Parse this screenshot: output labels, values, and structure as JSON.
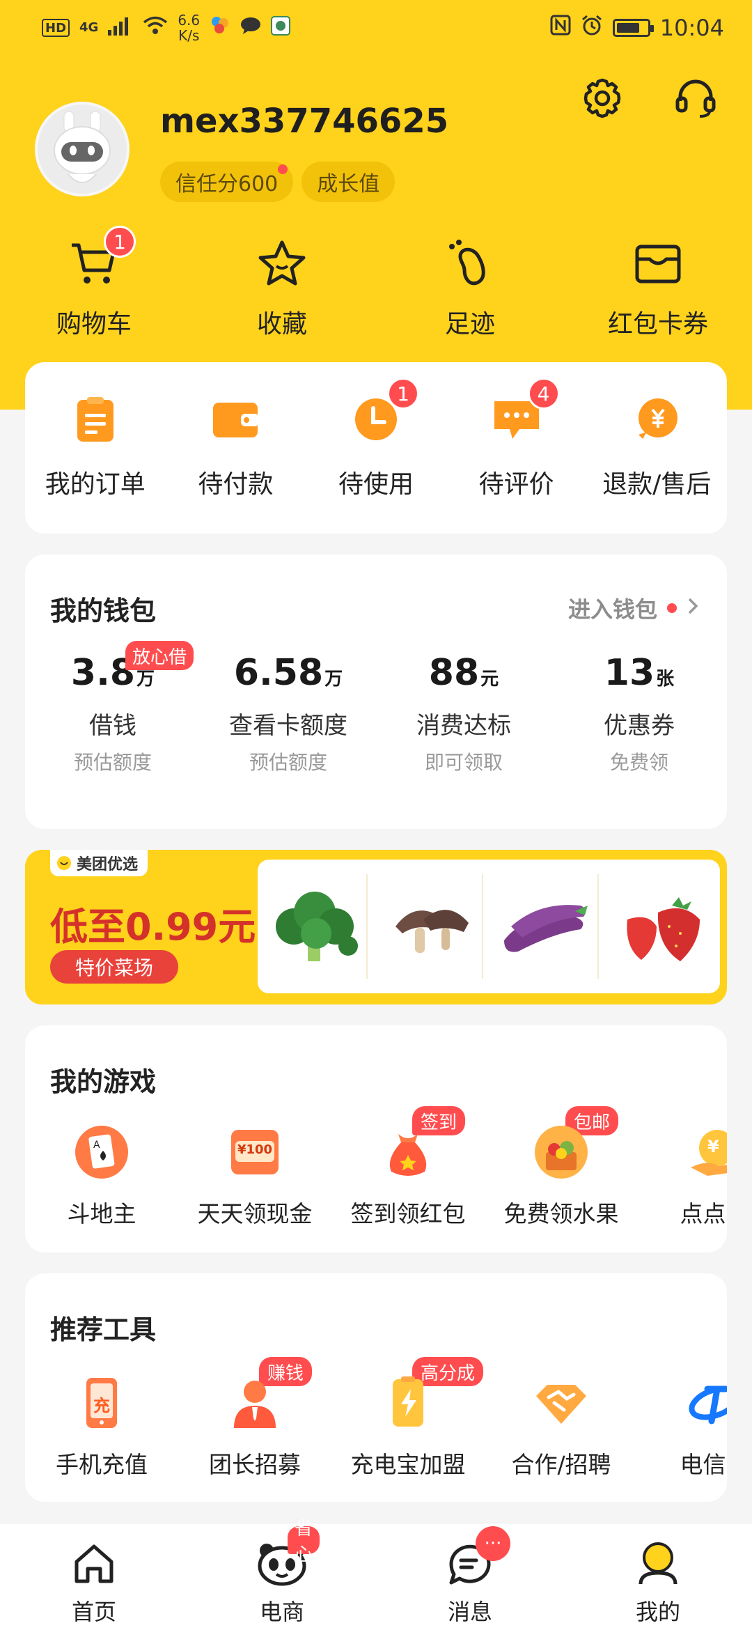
{
  "status_bar": {
    "network_chip": "HD",
    "network_type": "4G",
    "speed_value": "6.6",
    "speed_unit": "K/s",
    "time": "10:04",
    "battery_percent": 75
  },
  "profile": {
    "username": "mex337746625",
    "trust_score": "信任分600",
    "growth": "成长值"
  },
  "shortcuts": [
    {
      "label": "购物车",
      "icon": "cart-icon",
      "badge": "1"
    },
    {
      "label": "收藏",
      "icon": "star-icon"
    },
    {
      "label": "足迹",
      "icon": "footprint-icon"
    },
    {
      "label": "红包卡券",
      "icon": "wallet-card-icon"
    }
  ],
  "orders": [
    {
      "label": "我的订单",
      "icon": "order-clipboard-icon"
    },
    {
      "label": "待付款",
      "icon": "pending-payment-icon"
    },
    {
      "label": "待使用",
      "icon": "clock-icon",
      "badge": "1"
    },
    {
      "label": "待评价",
      "icon": "comment-icon",
      "badge": "4"
    },
    {
      "label": "退款/售后",
      "icon": "refund-icon"
    }
  ],
  "wallet": {
    "title": "我的钱包",
    "link": "进入钱包",
    "items": [
      {
        "value": "3.8",
        "unit": "万",
        "label": "借钱",
        "sub": "预估额度",
        "tag": "放心借"
      },
      {
        "value": "6.58",
        "unit": "万",
        "label": "查看卡额度",
        "sub": "预估额度"
      },
      {
        "value": "88",
        "unit": "元",
        "label": "消费达标",
        "sub": "即可领取"
      },
      {
        "value": "13",
        "unit": "张",
        "label": "优惠券",
        "sub": "免费领"
      }
    ]
  },
  "banner": {
    "brand": "美团优选",
    "headline": "低至0.99元",
    "button": "特价菜场",
    "products": [
      "broccoli",
      "mushroom",
      "eggplant",
      "strawberry"
    ]
  },
  "games": {
    "title": "我的游戏",
    "items": [
      {
        "label": "斗地主",
        "icon": "poker-card-icon"
      },
      {
        "label": "天天领现金",
        "icon": "cash-100-icon",
        "icon_text": "¥100"
      },
      {
        "label": "签到领红包",
        "icon": "red-packet-bag-icon",
        "tag": "签到"
      },
      {
        "label": "免费领水果",
        "icon": "fruit-box-icon",
        "tag": "包邮"
      },
      {
        "label": "点点就",
        "icon": "coin-hand-icon",
        "icon_text": "¥"
      }
    ]
  },
  "tools": {
    "title": "推荐工具",
    "items": [
      {
        "label": "手机充值",
        "icon": "phone-recharge-icon",
        "icon_text": "充"
      },
      {
        "label": "团长招募",
        "icon": "leader-recruit-icon",
        "tag": "赚钱"
      },
      {
        "label": "充电宝加盟",
        "icon": "power-bank-icon",
        "tag": "高分成"
      },
      {
        "label": "合作/招聘",
        "icon": "handshake-icon"
      },
      {
        "label": "电信营",
        "icon": "telecom-icon"
      }
    ]
  },
  "bottom_nav": [
    {
      "label": "首页",
      "icon": "home-icon"
    },
    {
      "label": "电商",
      "icon": "panda-icon",
      "tag": "省心"
    },
    {
      "label": "消息",
      "icon": "message-icon",
      "dot": "···"
    },
    {
      "label": "我的",
      "icon": "user-icon"
    }
  ],
  "colors": {
    "brand_yellow": "#ffd21c",
    "badge_red": "#ff4d4f",
    "icon_orange": "#ff9a1f"
  }
}
